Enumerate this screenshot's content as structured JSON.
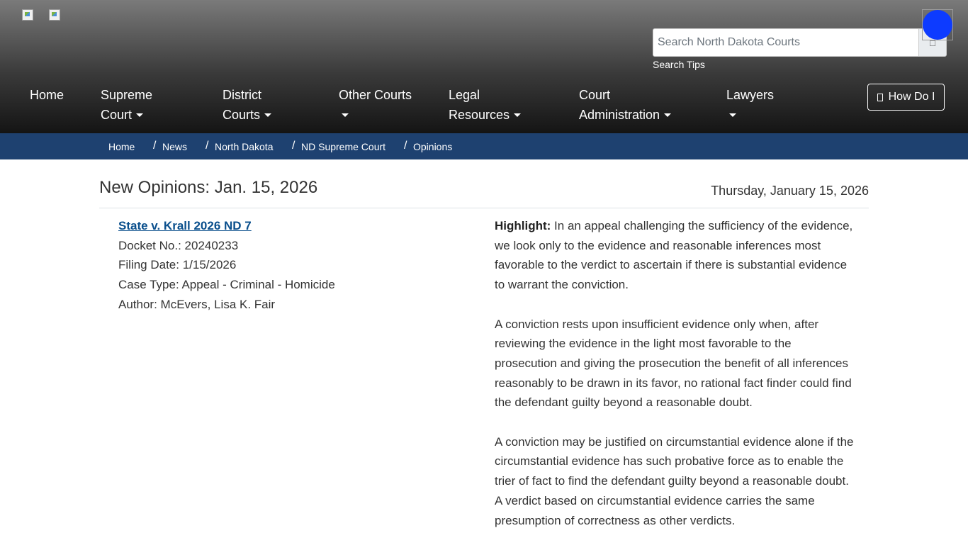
{
  "header": {
    "search": {
      "placeholder": "Search North Dakota Courts",
      "tips": "Search Tips"
    },
    "nav": [
      {
        "line1": "Home",
        "line2": ""
      },
      {
        "line1": "Supreme",
        "line2": "Court"
      },
      {
        "line1": "District",
        "line2": "Courts"
      },
      {
        "line1": "Other Courts",
        "line2": ""
      },
      {
        "line1": "Legal",
        "line2": "Resources"
      },
      {
        "line1": "Court",
        "line2": "Administration"
      },
      {
        "line1": "Lawyers",
        "line2": ""
      }
    ],
    "how_do_i": "How Do I"
  },
  "breadcrumb": [
    "Home",
    "News",
    "North Dakota",
    "ND Supreme Court",
    "Opinions"
  ],
  "main": {
    "title": "New Opinions: Jan. 15, 2026",
    "date": "Thursday, January 15, 2026",
    "opinion": {
      "case": "State v. Krall 2026 ND 7",
      "docket": "Docket No.: 20240233",
      "filing": "Filing Date: 1/15/2026",
      "case_type": "Case Type: Appeal - Criminal - Homicide",
      "author": "Author: McEvers, Lisa K. Fair",
      "highlight_label": "Highlight:",
      "paragraphs": [
        "In an appeal challenging the sufficiency of the evidence, we look only to the evidence and reasonable inferences most favorable to the verdict to ascertain if there is substantial evidence to warrant the conviction.",
        "A conviction rests upon insufficient evidence only when, after reviewing the evidence in the light most favorable to the prosecution and giving the prosecution the benefit of all inferences reasonably to be drawn in its favor, no rational fact finder could find the defendant guilty beyond a reasonable doubt.",
        "A conviction may be justified on circumstantial evidence alone if the circumstantial evidence has such probative force as to enable the trier of fact to find the defendant guilty beyond a reasonable doubt. A verdict based on circumstantial evidence carries the same presumption of correctness as other verdicts."
      ]
    }
  },
  "colors": {
    "breadcrumb_bg": "#1e4170",
    "link": "#0a4f8c",
    "floating_dot": "#0d3bff"
  }
}
